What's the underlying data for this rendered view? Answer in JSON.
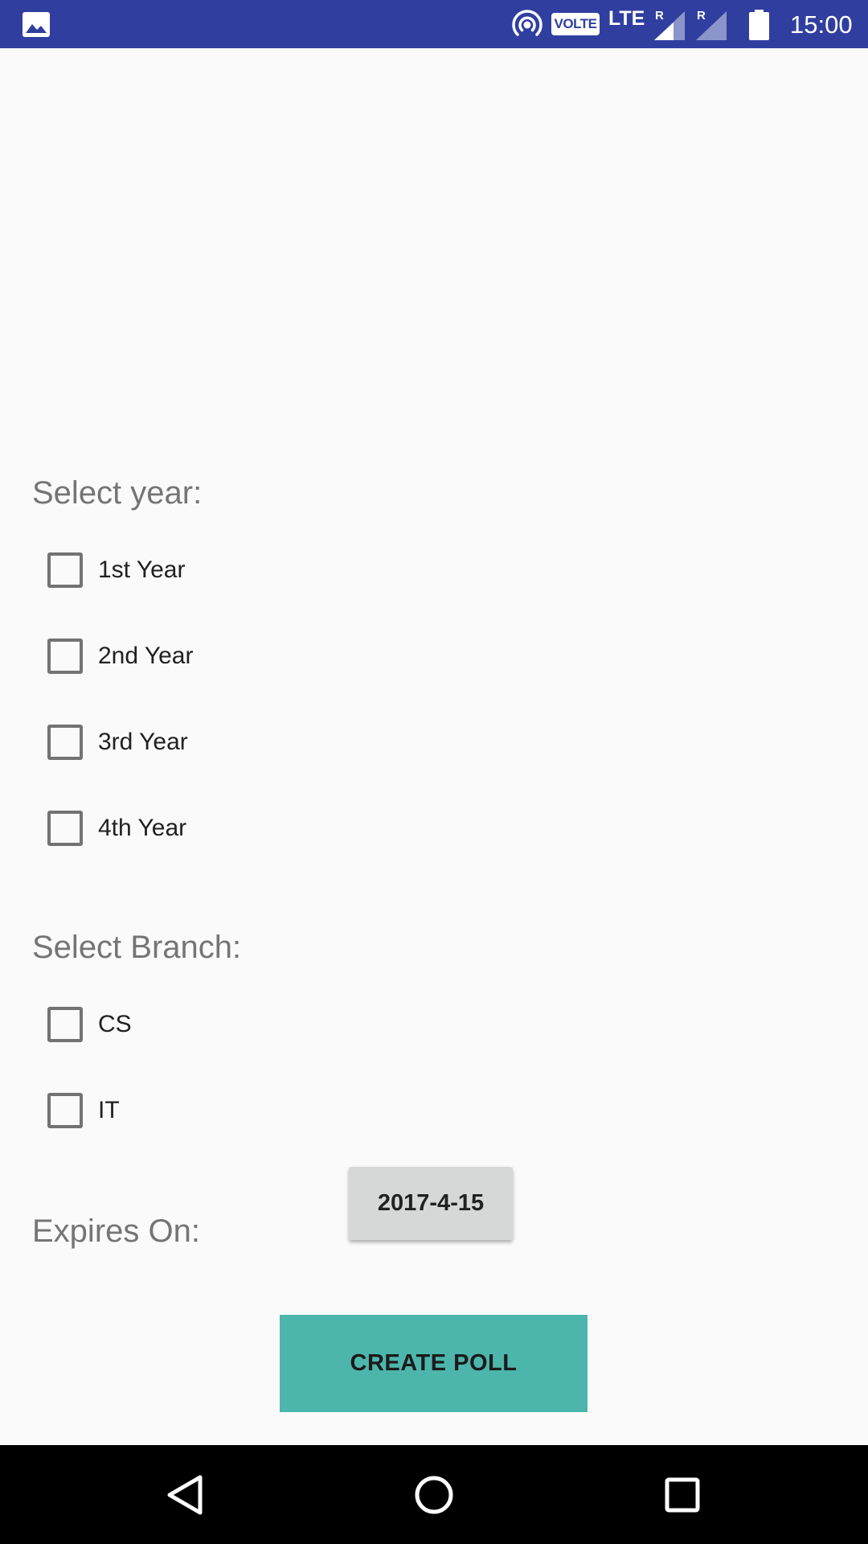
{
  "status_bar": {
    "time": "15:00",
    "volte": "VOLTE",
    "network": "LTE",
    "roaming_1": "R",
    "roaming_2": "R",
    "icons": [
      "gallery-icon",
      "hotspot-icon",
      "signal-icon",
      "battery-icon"
    ]
  },
  "form": {
    "year_section": {
      "label": "Select year:",
      "options": [
        {
          "label": "1st Year",
          "checked": false
        },
        {
          "label": "2nd Year",
          "checked": false
        },
        {
          "label": "3rd Year",
          "checked": false
        },
        {
          "label": "4th Year",
          "checked": false
        }
      ]
    },
    "branch_section": {
      "label": "Select Branch:",
      "options": [
        {
          "label": "CS",
          "checked": false
        },
        {
          "label": "IT",
          "checked": false
        }
      ]
    },
    "expires": {
      "label": "Expires On:",
      "date": "2017-4-15"
    },
    "create_label": "CREATE POLL"
  },
  "colors": {
    "status_bar": "#303f9f",
    "background": "#fafafa",
    "accent": "#4db6ac",
    "date_button": "#d6d7d7",
    "nav_bar": "#000000"
  },
  "nav_bar": {
    "icons": [
      "back-icon",
      "home-icon",
      "recents-icon"
    ]
  }
}
